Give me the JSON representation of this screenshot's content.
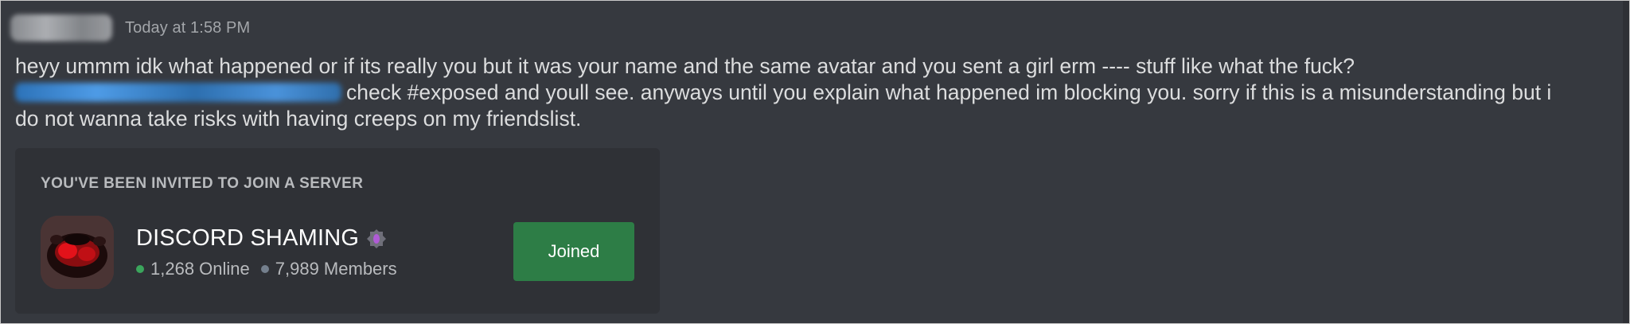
{
  "message": {
    "timestamp": "Today at 1:58 PM",
    "lines": [
      "heyy ummm idk what happened or if its really you but it was your name and the same avatar and you sent a girl erm ---- stuff like what the fuck?",
      "check #exposed and youll see. anyways until you explain what happened im blocking you. sorry if this is a misunderstanding but i",
      "do not wanna take risks with having creeps on my friendslist."
    ]
  },
  "invite": {
    "heading": "YOU'VE BEEN INVITED TO JOIN A SERVER",
    "server_name": "DISCORD SHAMING",
    "online": "1,268 Online",
    "members": "7,989 Members",
    "button_label": "Joined",
    "icon": "server-icon",
    "badge_icon": "partner-badge-icon"
  },
  "colors": {
    "background": "#36393f",
    "card": "#2f3136",
    "online": "#3ba55c",
    "members": "#747f8d",
    "button": "#2d7d46",
    "badge": "#9b59b6"
  }
}
